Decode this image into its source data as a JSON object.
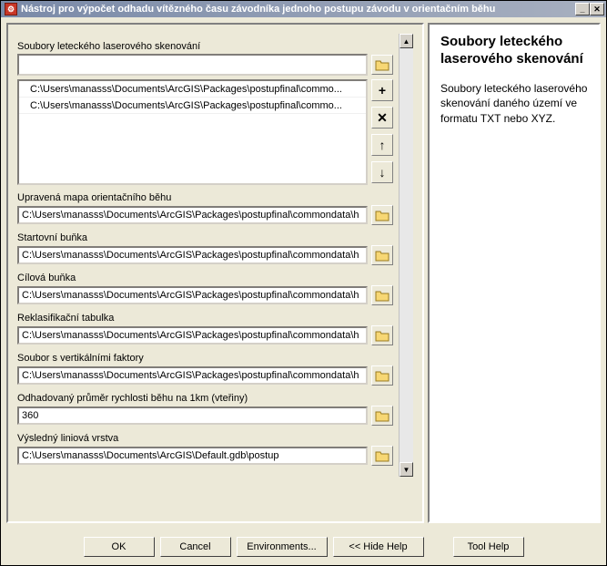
{
  "window": {
    "title": "Nástroj pro výpočet odhadu vítězného času závodníka jednoho postupu závodu v orientačním běhu"
  },
  "section_lidar": {
    "label": "Soubory leteckého laserového skenování",
    "input": "",
    "items": [
      "C:\\Users\\manasss\\Documents\\ArcGIS\\Packages\\postupfinal\\commo...",
      "C:\\Users\\manasss\\Documents\\ArcGIS\\Packages\\postupfinal\\commo..."
    ]
  },
  "fields": {
    "map": {
      "label": "Upravená mapa orientačního běhu",
      "value": "C:\\Users\\manasss\\Documents\\ArcGIS\\Packages\\postupfinal\\commondata\\h"
    },
    "start": {
      "label": "Startovní buňka",
      "value": "C:\\Users\\manasss\\Documents\\ArcGIS\\Packages\\postupfinal\\commondata\\h"
    },
    "goal": {
      "label": "Cílová buňka",
      "value": "C:\\Users\\manasss\\Documents\\ArcGIS\\Packages\\postupfinal\\commondata\\h"
    },
    "reclass": {
      "label": "Reklasifikační tabulka",
      "value": "C:\\Users\\manasss\\Documents\\ArcGIS\\Packages\\postupfinal\\commondata\\h"
    },
    "vfactor": {
      "label": "Soubor s vertikálními faktory",
      "value": "C:\\Users\\manasss\\Documents\\ArcGIS\\Packages\\postupfinal\\commondata\\h"
    },
    "speed": {
      "label": "Odhadovaný průměr rychlosti běhu na 1km (vteřiny)",
      "value": "360"
    },
    "output": {
      "label": "Výsledný liniová vrstva",
      "value": "C:\\Users\\manasss\\Documents\\ArcGIS\\Default.gdb\\postup"
    }
  },
  "buttons": {
    "ok": "OK",
    "cancel": "Cancel",
    "env": "Environments...",
    "hide": "<< Hide Help",
    "toolhelp": "Tool Help"
  },
  "help": {
    "title": "Soubory leteckého laserového skenování",
    "body": "Soubory leteckého laserového skenování daného území ve formatu TXT nebo XYZ."
  },
  "glyphs": {
    "plus": "+",
    "times": "✕",
    "up": "↑",
    "down": "↓",
    "scroll_up": "▲",
    "scroll_down": "▼"
  }
}
